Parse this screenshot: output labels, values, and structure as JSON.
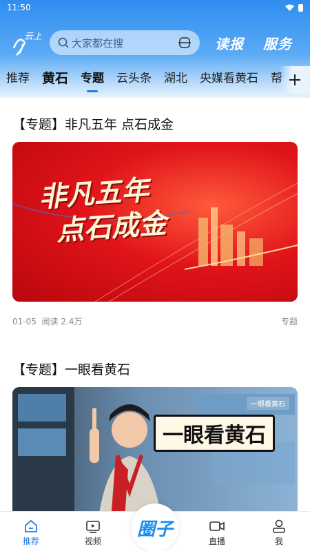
{
  "status": {
    "time": "11:50",
    "wifi_icon": "wifi-icon",
    "battery_icon": "battery-icon"
  },
  "header": {
    "logo_text": "云上",
    "search_placeholder": "大家都在搜",
    "read_label": "读报",
    "service_label": "服务"
  },
  "tabs": [
    "推荐",
    "黄石",
    "专题",
    "云头条",
    "湖北",
    "央媒看黄石",
    "帮"
  ],
  "active_tab": "专题",
  "cards": [
    {
      "title": "【专题】非凡五年 点石成金",
      "banner_text_1": "非凡五年",
      "banner_text_2": "点石成金",
      "date": "01-05",
      "reads": "阅读 2.4万",
      "category": "专题"
    },
    {
      "title": "【专题】一眼看黄石",
      "banner_text": "一眼看黄石",
      "banner_tag": "一眼看黄石"
    }
  ],
  "bottom_nav": {
    "home": "推荐",
    "video": "视频",
    "circle": "圈子",
    "live": "直播",
    "me": "我"
  },
  "colors": {
    "accent": "#1a7bec",
    "header_blue": "#2f8df0",
    "banner_red": "#e0141a"
  }
}
